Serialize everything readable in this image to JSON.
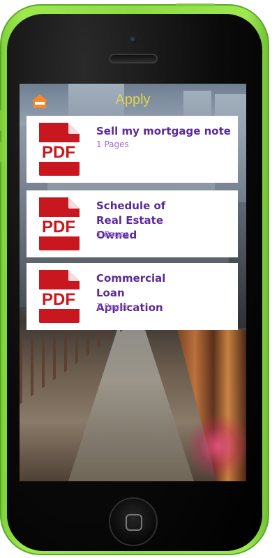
{
  "header": {
    "title": "Apply",
    "home_icon": "home-icon"
  },
  "documents": [
    {
      "title": "Sell my mortgage note",
      "pages": "1 Pages",
      "icon": "pdf-icon",
      "icon_label": "PDF"
    },
    {
      "title": "Schedule of Real Estate Owned",
      "pages": "1 Pages",
      "icon": "pdf-icon",
      "icon_label": "PDF"
    },
    {
      "title": "Commercial Loan Application",
      "pages": "7 Pages",
      "icon": "pdf-icon",
      "icon_label": "PDF"
    }
  ],
  "colors": {
    "phone_body": "#8edc45",
    "title": "#e3d44a",
    "doc_title": "#5b2a98",
    "doc_pages": "#9b6bd6",
    "home_icon": "#f08a2c",
    "pdf_red": "#c8171e"
  }
}
